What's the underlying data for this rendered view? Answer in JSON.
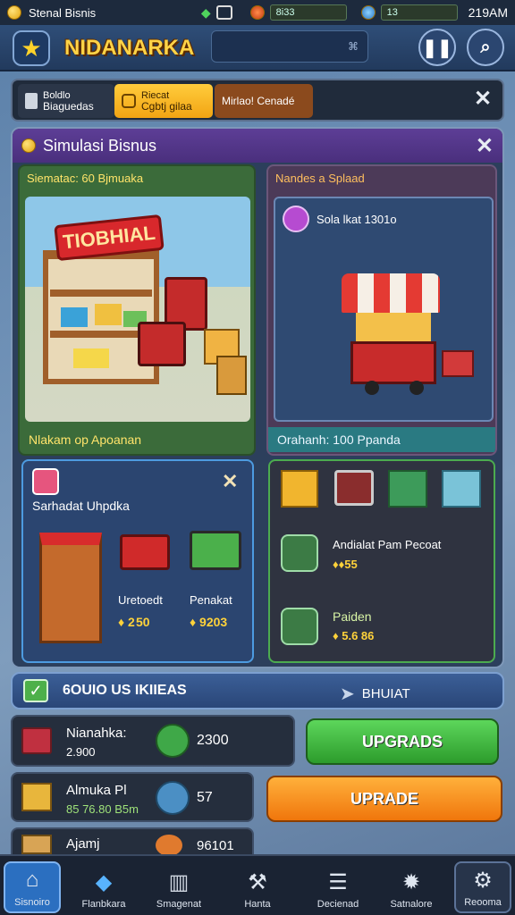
{
  "status": {
    "app": "Stenal Bisnis",
    "meter1": "8i33",
    "meter2": "13",
    "time": "219AM"
  },
  "header": {
    "title": "NIDANARKA",
    "search_icon_text": "⌘"
  },
  "tabs": [
    {
      "line1": "Boldlo",
      "line2": "Biaguedas"
    },
    {
      "line1": "Riecat",
      "line2": "Cgbtj gilaa"
    },
    {
      "line1": "Mirlao! Cenadé",
      "line2": ""
    }
  ],
  "panel": {
    "title": "Simulasi Bisnus",
    "store": {
      "title": "Siematac: 60 Bjmuaka",
      "sign": "TIOBHIAL",
      "footer": "Nlakam op Apoanan"
    },
    "stand": {
      "title": "Nandes a Splaad",
      "badge": "Sola lkat 1301o",
      "footer": "Orahanh: 100 Ppanda"
    },
    "upgrades": {
      "title": "Sarhadat Uhpdka",
      "items": [
        {
          "label": "Uretoedt",
          "price": "2 50"
        },
        {
          "label": "Penakat",
          "price": "9203"
        }
      ]
    },
    "rewards": {
      "items": [
        {
          "label": "Andialat Pam Pecoat",
          "value": "55"
        },
        {
          "label": "Paiden",
          "value": "5.6 86"
        }
      ]
    }
  },
  "bar": {
    "label": "6OUIO US IKIIEAS",
    "right": "BHUIAT"
  },
  "rows": [
    {
      "name": "Nianahka:",
      "sub": "2.900",
      "value": "2300",
      "button": "UPGRADS"
    },
    {
      "name": "Almuka Pl",
      "sub": "85 76.80 B5m",
      "value": "57",
      "button": "UPRADE"
    },
    {
      "name": "Ajamj",
      "sub": "",
      "value": "96101",
      "button": ""
    }
  ],
  "nav": [
    {
      "label": "Sisnoiro",
      "icon": "home-icon"
    },
    {
      "label": "Flanbkara",
      "icon": "diamond-icon"
    },
    {
      "label": "Smagenat",
      "icon": "bin-icon"
    },
    {
      "label": "Hanta",
      "icon": "wrench-icon"
    },
    {
      "label": "Decienad",
      "icon": "list-icon"
    },
    {
      "label": "Satnalore",
      "icon": "badge-icon"
    },
    {
      "label": "Reooma",
      "icon": "gear-icon"
    }
  ]
}
